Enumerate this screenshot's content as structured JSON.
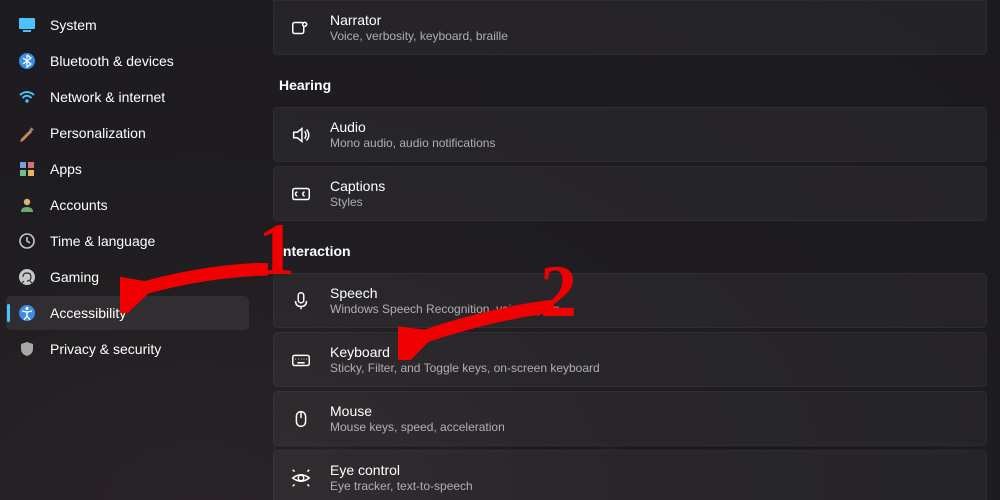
{
  "sidebar": {
    "items": [
      {
        "label": "System",
        "icon": "system"
      },
      {
        "label": "Bluetooth & devices",
        "icon": "bluetooth"
      },
      {
        "label": "Network & internet",
        "icon": "wifi"
      },
      {
        "label": "Personalization",
        "icon": "personalization"
      },
      {
        "label": "Apps",
        "icon": "apps"
      },
      {
        "label": "Accounts",
        "icon": "accounts"
      },
      {
        "label": "Time & language",
        "icon": "time"
      },
      {
        "label": "Gaming",
        "icon": "gaming"
      },
      {
        "label": "Accessibility",
        "icon": "accessibility"
      },
      {
        "label": "Privacy & security",
        "icon": "privacy"
      }
    ]
  },
  "main": {
    "top_card": {
      "title": "Narrator",
      "sub": "Voice, verbosity, keyboard, braille"
    },
    "sections": [
      {
        "heading": "Hearing",
        "cards": [
          {
            "title": "Audio",
            "sub": "Mono audio, audio notifications",
            "icon": "audio"
          },
          {
            "title": "Captions",
            "sub": "Styles",
            "icon": "captions"
          }
        ]
      },
      {
        "heading": "Interaction",
        "cards": [
          {
            "title": "Speech",
            "sub": "Windows Speech Recognition, voice typing",
            "icon": "speech"
          },
          {
            "title": "Keyboard",
            "sub": "Sticky, Filter, and Toggle keys, on-screen keyboard",
            "icon": "keyboard"
          },
          {
            "title": "Mouse",
            "sub": "Mouse keys, speed, acceleration",
            "icon": "mouse"
          },
          {
            "title": "Eye control",
            "sub": "Eye tracker, text-to-speech",
            "icon": "eye"
          }
        ]
      }
    ]
  },
  "annotations": {
    "one": "1",
    "two": "2"
  }
}
